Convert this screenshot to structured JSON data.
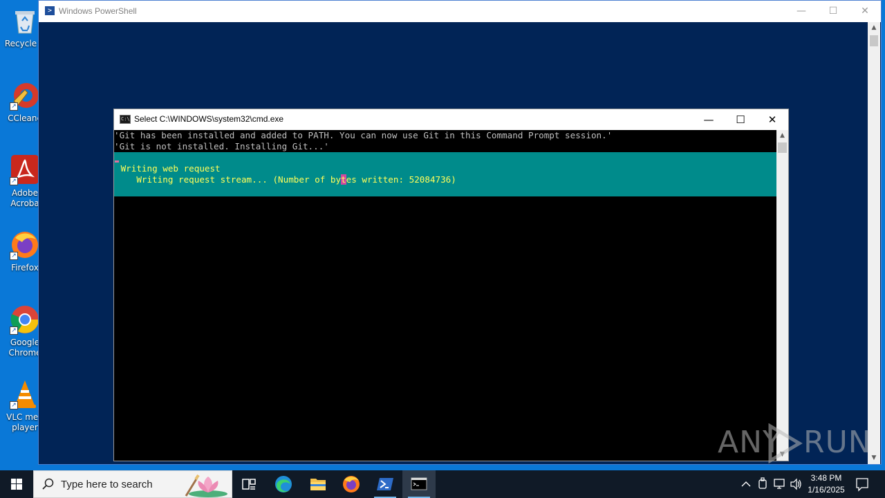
{
  "desktop": {
    "icons": [
      {
        "label": "Recycle B",
        "icon": "recycle-bin-icon"
      },
      {
        "label": "CCleane",
        "icon": "ccleaner-icon"
      },
      {
        "label": "Adobe Acroba",
        "icon": "adobe-acrobat-icon"
      },
      {
        "label": "Firefox",
        "icon": "firefox-icon"
      },
      {
        "label": "Google Chrome",
        "icon": "chrome-icon"
      },
      {
        "label": "VLC med player",
        "icon": "vlc-icon"
      }
    ]
  },
  "powershell_window": {
    "title": "Windows PowerShell",
    "controls": {
      "minimize": "—",
      "maximize": "☐",
      "close": "✕"
    }
  },
  "cmd_window": {
    "title": "Select C:\\WINDOWS\\system32\\cmd.exe",
    "controls": {
      "minimize": "—",
      "maximize": "☐",
      "close": "✕"
    },
    "console_lines": [
      "'Git has been installed and added to PATH. You can now use Git in this Command Prompt session.'",
      "'Git is not installed. Installing Git...'"
    ],
    "progress": {
      "activity": " Writing web request",
      "status_before_cursor": "    Writing request stream... (Number of by",
      "status_cursor_char": "t",
      "status_after_cursor": "es written: 52084736)"
    }
  },
  "watermark": {
    "left": "ANY",
    "right": "RUN"
  },
  "taskbar": {
    "search_placeholder": "Type here to search",
    "apps": [
      {
        "name": "task-view",
        "icon": "task-view-icon"
      },
      {
        "name": "edge",
        "icon": "edge-icon"
      },
      {
        "name": "file-explorer",
        "icon": "folder-icon"
      },
      {
        "name": "firefox",
        "icon": "firefox-icon"
      },
      {
        "name": "powershell",
        "icon": "powershell-icon"
      },
      {
        "name": "cmd",
        "icon": "cmd-icon"
      }
    ],
    "clock": {
      "time": "3:48 PM",
      "date": "1/16/2025"
    }
  },
  "colors": {
    "desktop": "#0a78d7",
    "powershell_bg": "#012456",
    "progress_bg": "#008b8b",
    "progress_text": "#ffff5a",
    "console_text": "#c0c0c0",
    "taskbar": "#101a27"
  }
}
